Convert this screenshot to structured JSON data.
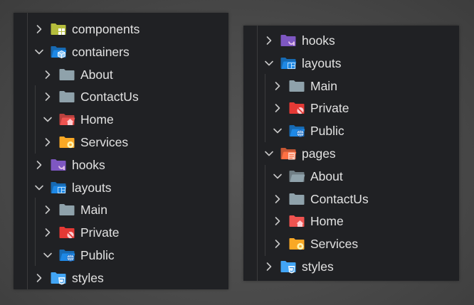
{
  "left_panel": {
    "items": [
      {
        "label": "components",
        "depth": 0,
        "expanded": false,
        "icon": "components-folder-icon",
        "color": "#b5bd3c"
      },
      {
        "label": "containers",
        "depth": 0,
        "expanded": true,
        "icon": "containers-folder-icon",
        "color": "#1e88e5"
      },
      {
        "label": "About",
        "depth": 1,
        "expanded": false,
        "icon": "folder-icon",
        "color": "#8fa2ab"
      },
      {
        "label": "ContactUs",
        "depth": 1,
        "expanded": false,
        "icon": "folder-icon",
        "color": "#8fa2ab"
      },
      {
        "label": "Home",
        "depth": 1,
        "expanded": true,
        "icon": "home-folder-open-icon",
        "color": "#ef5350"
      },
      {
        "label": "Services",
        "depth": 1,
        "expanded": false,
        "icon": "services-folder-icon",
        "color": "#f9a825"
      },
      {
        "label": "hooks",
        "depth": 0,
        "expanded": false,
        "icon": "hooks-folder-icon",
        "color": "#7e57c2"
      },
      {
        "label": "layouts",
        "depth": 0,
        "expanded": true,
        "icon": "layouts-folder-open-icon",
        "color": "#1e88e5"
      },
      {
        "label": "Main",
        "depth": 1,
        "expanded": false,
        "icon": "folder-icon",
        "color": "#8fa2ab"
      },
      {
        "label": "Private",
        "depth": 1,
        "expanded": false,
        "icon": "private-folder-icon",
        "color": "#e53935"
      },
      {
        "label": "Public",
        "depth": 1,
        "expanded": true,
        "icon": "public-folder-open-icon",
        "color": "#1e88e5"
      },
      {
        "label": "styles",
        "depth": 0,
        "expanded": false,
        "icon": "styles-folder-icon",
        "color": "#42a5f5"
      }
    ]
  },
  "right_panel": {
    "items": [
      {
        "label": "hooks",
        "depth": 0,
        "expanded": false,
        "icon": "hooks-folder-icon",
        "color": "#7e57c2"
      },
      {
        "label": "layouts",
        "depth": 0,
        "expanded": true,
        "icon": "layouts-folder-open-icon",
        "color": "#1e88e5"
      },
      {
        "label": "Main",
        "depth": 1,
        "expanded": false,
        "icon": "folder-icon",
        "color": "#8fa2ab"
      },
      {
        "label": "Private",
        "depth": 1,
        "expanded": false,
        "icon": "private-folder-icon",
        "color": "#e53935"
      },
      {
        "label": "Public",
        "depth": 1,
        "expanded": true,
        "icon": "public-folder-open-icon",
        "color": "#1e88e5"
      },
      {
        "label": "pages",
        "depth": 0,
        "expanded": true,
        "icon": "pages-folder-open-icon",
        "color": "#ff7043"
      },
      {
        "label": "About",
        "depth": 1,
        "expanded": true,
        "icon": "folder-open-icon",
        "color": "#8fa2ab"
      },
      {
        "label": "ContactUs",
        "depth": 1,
        "expanded": false,
        "icon": "folder-icon",
        "color": "#8fa2ab"
      },
      {
        "label": "Home",
        "depth": 1,
        "expanded": false,
        "icon": "home-folder-icon",
        "color": "#ef5350"
      },
      {
        "label": "Services",
        "depth": 1,
        "expanded": false,
        "icon": "services-folder-icon",
        "color": "#f9a825"
      },
      {
        "label": "styles",
        "depth": 0,
        "expanded": false,
        "icon": "styles-folder-icon",
        "color": "#42a5f5"
      }
    ]
  }
}
